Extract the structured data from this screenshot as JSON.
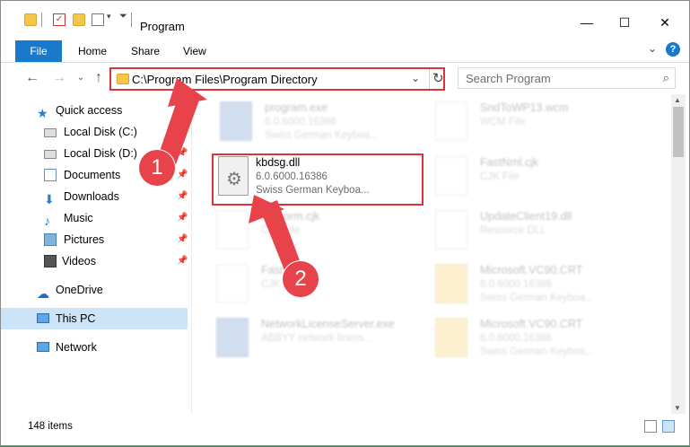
{
  "window": {
    "title": "Program"
  },
  "ribbon": {
    "tabs": [
      "File",
      "Home",
      "Share",
      "View"
    ]
  },
  "address": {
    "path": "C:\\Program Files\\Program Directory"
  },
  "search": {
    "placeholder": "Search Program"
  },
  "sidebar": {
    "items": [
      {
        "label": "Quick access",
        "icon": "star-icon"
      },
      {
        "label": "Local Disk (C:)",
        "icon": "drive-icon",
        "pinned": true
      },
      {
        "label": "Local Disk (D:)",
        "icon": "drive-icon",
        "pinned": true
      },
      {
        "label": "Documents",
        "icon": "documents-icon",
        "pinned": true
      },
      {
        "label": "Downloads",
        "icon": "download-icon",
        "pinned": true
      },
      {
        "label": "Music",
        "icon": "music-icon",
        "pinned": true
      },
      {
        "label": "Pictures",
        "icon": "pictures-icon",
        "pinned": true
      },
      {
        "label": "Videos",
        "icon": "videos-icon",
        "pinned": true
      },
      {
        "label": "OneDrive",
        "icon": "cloud-icon"
      },
      {
        "label": "This PC",
        "icon": "computer-icon",
        "selected": true
      },
      {
        "label": "Network",
        "icon": "network-icon"
      }
    ]
  },
  "files": [
    {
      "name": "program.exe",
      "line2": "6.0.6000.16386",
      "line3": "Swiss German Keyboa...",
      "kind": "exe",
      "faded": true
    },
    {
      "name": "SndToWP13.wcm",
      "line2": "WCM File",
      "line3": "",
      "kind": "doc",
      "faded": true
    },
    {
      "name": "kbdsg.dll",
      "line2": "6.0.6000.16386",
      "line3": "Swiss German Keyboa...",
      "kind": "dll",
      "faded": false
    },
    {
      "name": "FastNml.cjk",
      "line2": "CJK File",
      "line3": "",
      "kind": "doc",
      "faded": true
    },
    {
      "name": "Fa...orm.cjk",
      "line2": "CJK File",
      "line3": "",
      "kind": "doc",
      "faded": true
    },
    {
      "name": "UpdateClient19.dll",
      "line2": "Resource DLL",
      "line3": "",
      "kind": "dll",
      "faded": true
    },
    {
      "name": "FastM...jk",
      "line2": "CJK File",
      "line3": "",
      "kind": "doc",
      "faded": true
    },
    {
      "name": "Microsoft.VC90.CRT",
      "line2": "6.0.6000.16386",
      "line3": "Swiss German Keyboa...",
      "kind": "zip",
      "faded": true
    },
    {
      "name": "NetworkLicenseServer.exe",
      "line2": "ABBYY network licens...",
      "line3": "",
      "kind": "exe",
      "faded": true
    },
    {
      "name": "Microsoft.VC90.CRT",
      "line2": "6.0.6000.16386",
      "line3": "Swiss German Keyboa...",
      "kind": "zip",
      "faded": true
    }
  ],
  "callouts": [
    "1",
    "2"
  ],
  "status": {
    "item_count": "148 items"
  },
  "colors": {
    "accent": "#1979ca",
    "highlight": "#e0303a",
    "selection": "#cce4f7"
  }
}
